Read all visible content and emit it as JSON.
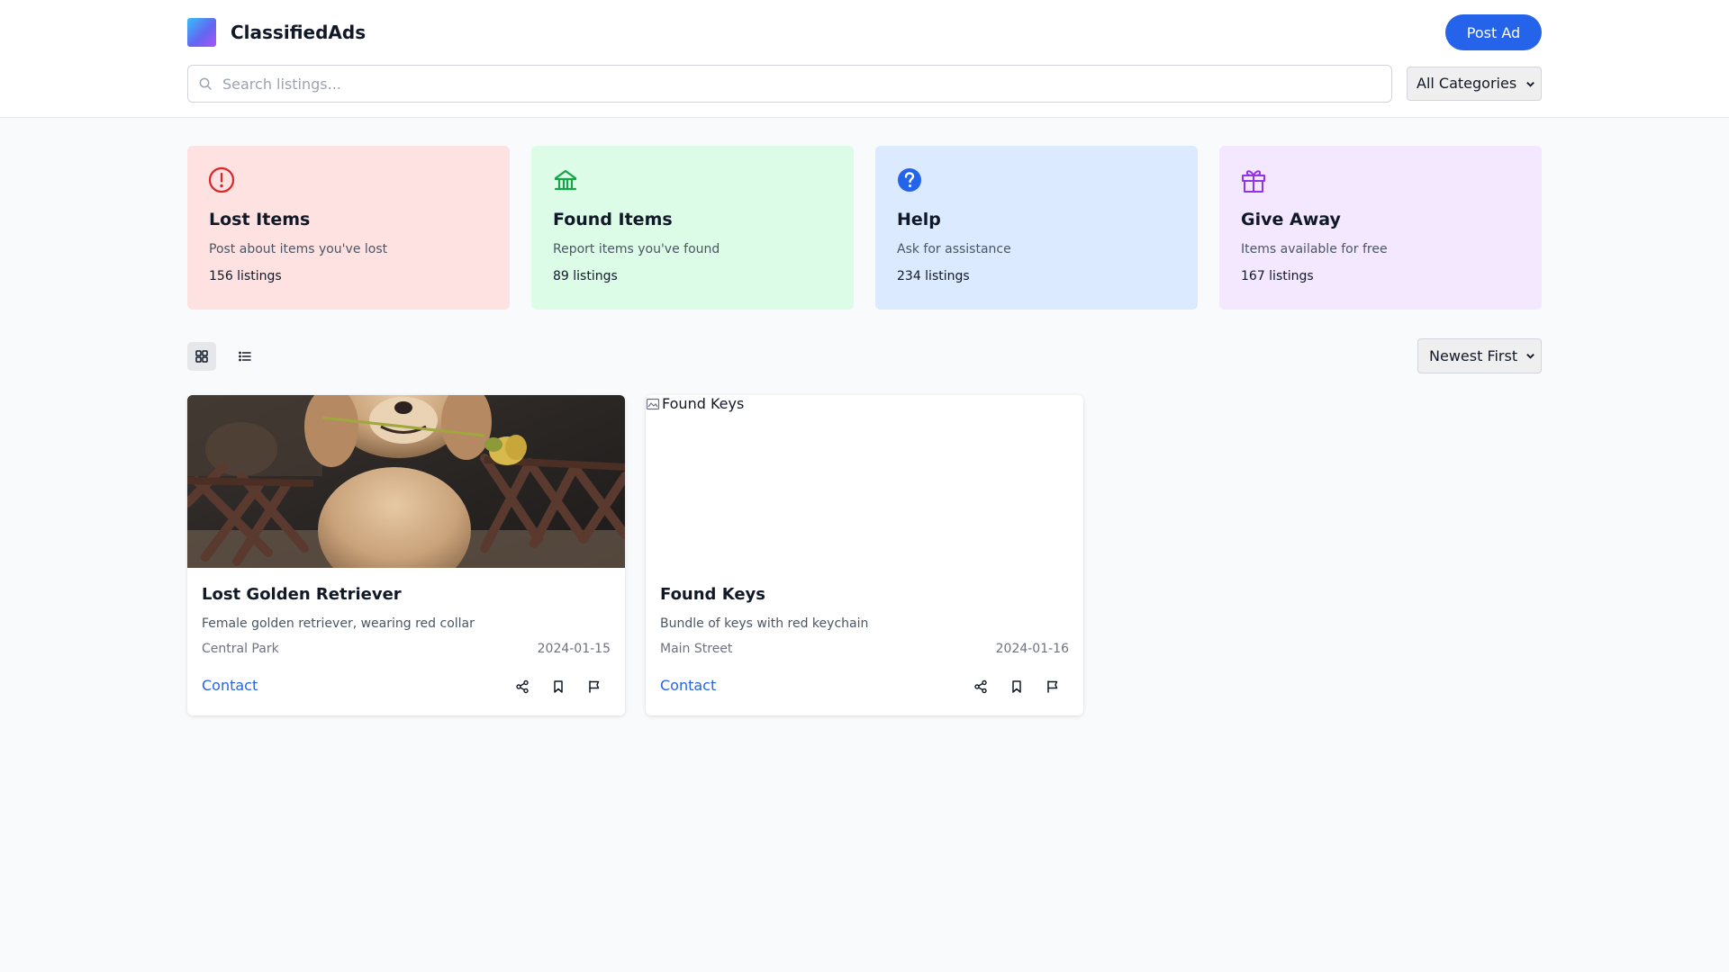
{
  "header": {
    "brand": "ClassifiedAds",
    "post_button": "Post Ad",
    "search_placeholder": "Search listings...",
    "category_select": "All Categories"
  },
  "categories": [
    {
      "title": "Lost Items",
      "description": "Post about items you've lost",
      "count": "156 listings",
      "icon": "alert-circle-icon",
      "bg": "#fee2e2",
      "accent": "#dc2626"
    },
    {
      "title": "Found Items",
      "description": "Report items you've found",
      "count": "89 listings",
      "icon": "building-icon",
      "bg": "#dcfce7",
      "accent": "#16a34a"
    },
    {
      "title": "Help",
      "description": "Ask for assistance",
      "count": "234 listings",
      "icon": "help-circle-icon",
      "bg": "#dbeafe",
      "accent": "#2563eb"
    },
    {
      "title": "Give Away",
      "description": "Items available for free",
      "count": "167 listings",
      "icon": "gift-icon",
      "bg": "#f3e8ff",
      "accent": "#9333ea"
    }
  ],
  "toolbar": {
    "sort_select": "Newest First"
  },
  "listings": [
    {
      "title": "Lost Golden Retriever",
      "description": "Female golden retriever, wearing red collar",
      "location": "Central Park",
      "date": "2024-01-15",
      "contact": "Contact"
    },
    {
      "title": "Found Keys",
      "description": "Bundle of keys with red keychain",
      "location": "Main Street",
      "date": "2024-01-16",
      "contact": "Contact",
      "image_alt": "Found Keys"
    }
  ],
  "colors": {
    "primary": "#2563eb"
  }
}
